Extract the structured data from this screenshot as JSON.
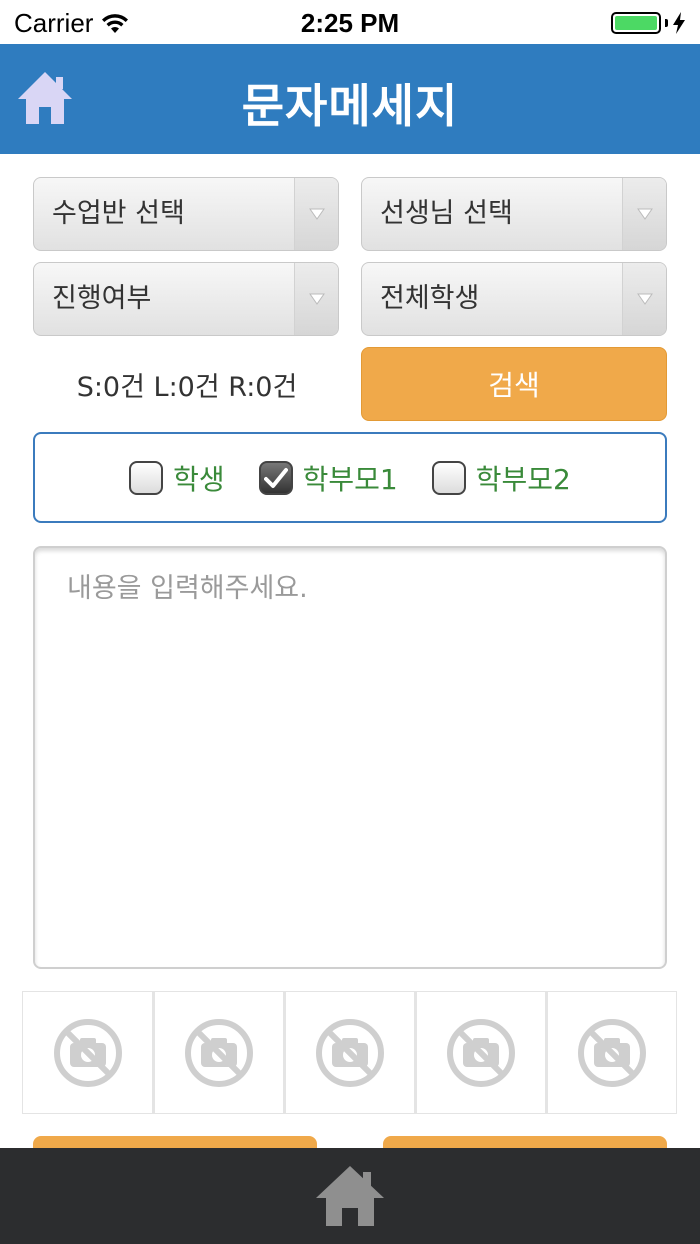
{
  "status_bar": {
    "carrier": "Carrier",
    "time": "2:25 PM",
    "battery_color": "#4cd964"
  },
  "header": {
    "title": "문자메세지",
    "home_icon": "home-icon",
    "background": "#2f7cbf"
  },
  "filters": {
    "class_select": "수업반 선택",
    "teacher_select": "선생님 선택",
    "progress_select": "진행여부",
    "students_select": "전체학생"
  },
  "counts": {
    "text": "S:0건 L:0건 R:0건"
  },
  "search_button": {
    "label": "검색",
    "color": "#f0a94a"
  },
  "recipients": {
    "items": [
      {
        "label": "학생",
        "checked": false
      },
      {
        "label": "학부모1",
        "checked": true
      },
      {
        "label": "학부모2",
        "checked": false
      }
    ]
  },
  "message": {
    "placeholder": "내용을 입력해주세요.",
    "value": ""
  },
  "photos": {
    "slot_icon": "no-photo-icon",
    "slots": 5
  },
  "tab_bar": {
    "home_icon": "home-icon",
    "background": "#2c2d2f"
  }
}
